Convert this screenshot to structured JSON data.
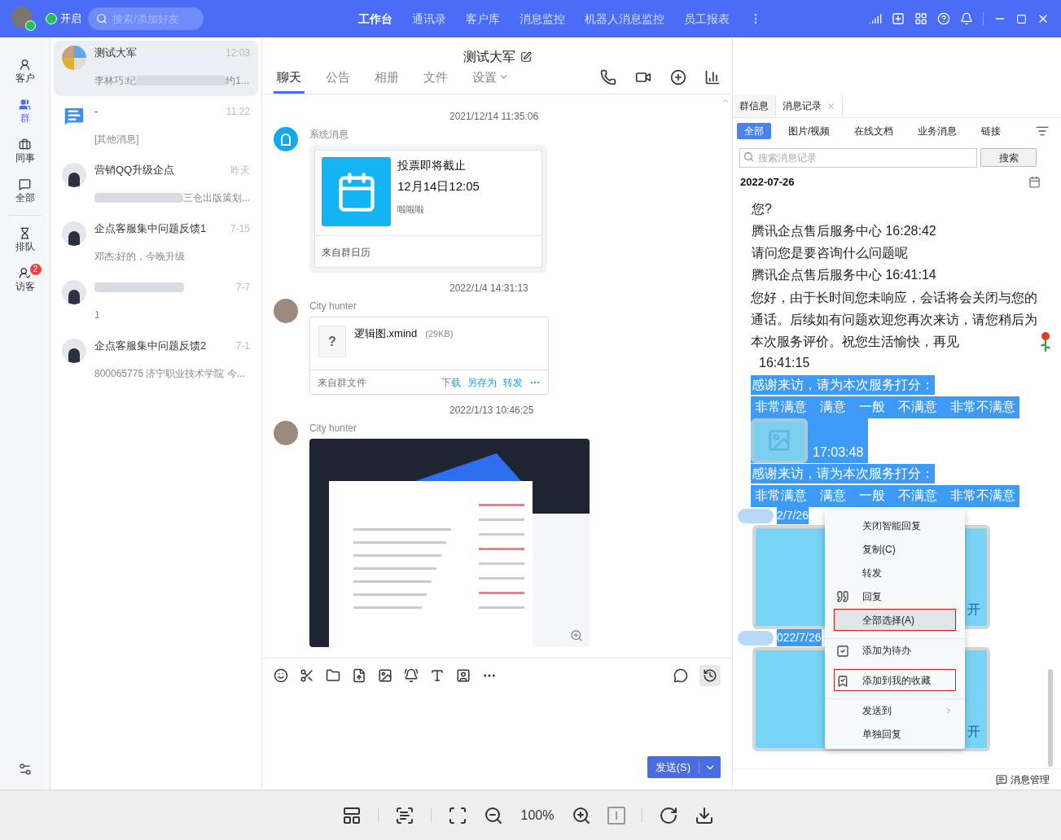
{
  "topbar": {
    "status": "开启",
    "search": {
      "placeholder": "搜索/添加好友"
    },
    "nav": [
      {
        "label": "工作台",
        "selected": true
      },
      {
        "label": "通讯录",
        "selected": false
      },
      {
        "label": "客户库",
        "selected": false
      },
      {
        "label": "消息监控",
        "selected": false
      },
      {
        "label": "机器人消息监控",
        "selected": false
      },
      {
        "label": "员工报表",
        "selected": false
      }
    ]
  },
  "left_nav": [
    {
      "label": "客户",
      "selected": false
    },
    {
      "label": "群",
      "selected": true
    },
    {
      "label": "同事",
      "selected": false
    },
    {
      "label": "全部",
      "selected": false
    },
    {
      "label": "排队",
      "selected": false,
      "divider_before": true
    },
    {
      "label": "访客",
      "selected": false,
      "badge": "2"
    }
  ],
  "conversations": [
    {
      "name": [
        {
          "kind": "text",
          "text": "测试大军"
        }
      ],
      "time": "12:03",
      "preview": [
        {
          "kind": "text",
          "text": "李林巧:纪"
        },
        {
          "kind": "redacted"
        },
        {
          "kind": "text",
          "text": "约1..."
        }
      ],
      "selected": true
    },
    {
      "name": [
        {
          "kind": "text",
          "text": "-"
        }
      ],
      "time": "11:22",
      "preview": [
        {
          "kind": "text",
          "text": "[其他消息]"
        }
      ],
      "selected": false
    },
    {
      "name": [
        {
          "kind": "text",
          "text": "营销QQ升级企点"
        }
      ],
      "time": "昨天",
      "preview": [
        {
          "kind": "redacted"
        },
        {
          "kind": "text",
          "text": "三仓出版策划..."
        }
      ],
      "selected": false
    },
    {
      "name": [
        {
          "kind": "text",
          "text": "企点客服集中问题反馈1"
        }
      ],
      "time": "7-15",
      "preview": [
        {
          "kind": "text",
          "text": "邓杰:好的，今晚升级"
        }
      ],
      "selected": false
    },
    {
      "name": [
        {
          "kind": "redacted"
        }
      ],
      "time": "7-7",
      "preview": [
        {
          "kind": "text",
          "text": "1"
        }
      ],
      "selected": false
    },
    {
      "name": [
        {
          "kind": "text",
          "text": "企点客服集中问题反馈2"
        }
      ],
      "time": "7-1",
      "preview": [
        {
          "kind": "text",
          "text": "800065775 济宁职业技术学院 今..."
        }
      ],
      "selected": false
    }
  ],
  "chat": {
    "title": "测试大军",
    "tabs": [
      {
        "label": "聊天",
        "selected": true
      },
      {
        "label": "公告",
        "selected": false
      },
      {
        "label": "相册",
        "selected": false
      },
      {
        "label": "文件",
        "selected": false
      },
      {
        "label": "设置",
        "selected": false,
        "has_menu": true
      }
    ],
    "messages": [
      {
        "kind": "calendar",
        "time": "2021/12/14 11:35:06",
        "sender": "系统消息",
        "title": "投票即将截止",
        "date": "12月14日12:05",
        "note": "啦啦啦",
        "footer": "来自群日历"
      },
      {
        "kind": "file",
        "time": "2022/1/4 14:31:13",
        "sender": "City hunter",
        "file_glyph": "?",
        "file_name": "逻辑图.xmind",
        "size": "(29KB)",
        "footer": "来自群文件",
        "actions": [
          "下载",
          "另存为",
          "转发"
        ]
      },
      {
        "kind": "image",
        "time": "2022/1/13 10:46:25",
        "sender": "City hunter"
      }
    ],
    "send": {
      "label": "发送(S)"
    }
  },
  "records": {
    "tabs": [
      {
        "label": "群信息",
        "selected": false,
        "closable": false
      },
      {
        "label": "消息记录",
        "selected": true,
        "closable": true
      }
    ],
    "filters": [
      {
        "label": "全部",
        "selected": true
      },
      {
        "label": "图片/视频",
        "selected": false
      },
      {
        "label": "在线文档",
        "selected": false
      },
      {
        "label": "业务消息",
        "selected": false
      },
      {
        "label": "链接",
        "selected": false
      }
    ],
    "search": {
      "placeholder": "搜索消息记录",
      "button": "搜索"
    },
    "date": "2022-07-26",
    "lines": [
      {
        "kind": "text",
        "text": "您?",
        "selected": false
      },
      {
        "kind": "text",
        "text": "腾讯企点售后服务中心 16:28:42",
        "selected": false
      },
      {
        "kind": "text",
        "text": "请问您是要咨询什么问题呢",
        "selected": false
      },
      {
        "kind": "text",
        "text": "腾讯企点售后服务中心 16:41:14",
        "selected": false
      },
      {
        "kind": "paragraph",
        "text": "您好，由于长时间您未响应，会话将会关闭与您的通话。后续如有问题欢迎您再次来访，请您稍后为本次服务评价。祝您生活愉快，再见",
        "selected": false
      },
      {
        "kind": "indent",
        "text": "16:41:15",
        "selected": false
      },
      {
        "kind": "text",
        "text": "感谢来访，请为本次服务打分：",
        "selected": true
      },
      {
        "kind": "rating",
        "options": [
          "非常满意",
          "满意",
          "一般",
          "不满意",
          "非常不满意"
        ],
        "selected": true
      },
      {
        "kind": "image",
        "text": "17:03:48",
        "selected": true
      },
      {
        "kind": "text",
        "text": "感谢来访，请为本次服务打分：",
        "selected": true
      },
      {
        "kind": "rating",
        "options": [
          "非常满意",
          "满意",
          "一般",
          "不满意",
          "非常不满意"
        ],
        "selected": true
      },
      {
        "kind": "card",
        "time": "2/7/26",
        "action": "开",
        "selected": true
      },
      {
        "kind": "card",
        "time": "022/7/26",
        "action": "开",
        "selected": true
      }
    ],
    "footer": "消息管理"
  },
  "context_menu": [
    {
      "label": "关闭智能回复",
      "kind": "plain",
      "hovered": false,
      "outlined": false,
      "divider_before": false,
      "submenu": false
    },
    {
      "label": "复制(C)",
      "kind": "plain",
      "hovered": false,
      "outlined": false,
      "divider_before": false,
      "submenu": false
    },
    {
      "label": "转发",
      "kind": "plain",
      "hovered": false,
      "outlined": false,
      "divider_before": false,
      "submenu": false
    },
    {
      "label": "回复",
      "kind": "quote",
      "hovered": false,
      "outlined": false,
      "divider_before": false,
      "submenu": false
    },
    {
      "label": "全部选择(A)",
      "kind": "plain",
      "hovered": true,
      "outlined": true,
      "divider_before": false,
      "submenu": false
    },
    {
      "label": "添加为待办",
      "kind": "todo",
      "hovered": false,
      "outlined": false,
      "divider_before": true,
      "submenu": false
    },
    {
      "label": "添加到我的收藏",
      "kind": "bookmark",
      "hovered": false,
      "outlined": true,
      "divider_before": true,
      "submenu": false
    },
    {
      "label": "发送到",
      "kind": "plain",
      "hovered": false,
      "outlined": false,
      "divider_before": true,
      "submenu": true
    },
    {
      "label": "单独回复",
      "kind": "plain",
      "hovered": false,
      "outlined": false,
      "divider_before": false,
      "submenu": false
    }
  ],
  "viewer": {
    "zoom": "100%"
  }
}
